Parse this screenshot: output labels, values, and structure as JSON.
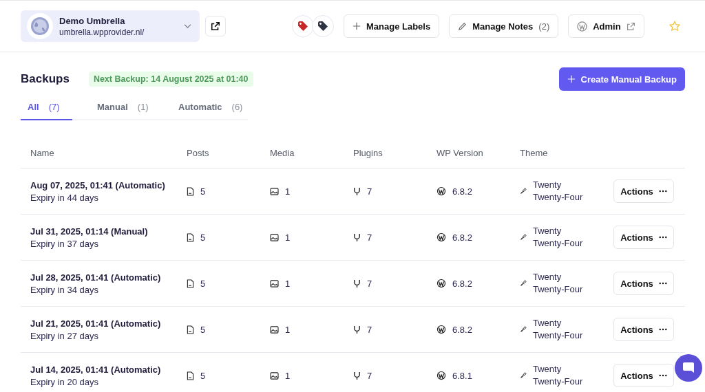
{
  "site": {
    "name": "Demo Umbrella",
    "url": "umbrella.wpprovider.nl/"
  },
  "labels": [
    {
      "color": "#c62828"
    },
    {
      "color": "#2d3340"
    }
  ],
  "header_buttons": [
    {
      "kind": "labels",
      "label": "Manage Labels"
    },
    {
      "kind": "notes",
      "label": "Manage Notes",
      "count": "(2)"
    },
    {
      "kind": "admin",
      "label": "Admin"
    }
  ],
  "favorite": {
    "on": false
  },
  "title": "Backups",
  "next_backup": "Next Backup: 14 August 2025 at 01:40",
  "create_button": "Create Manual Backup",
  "tabs": [
    {
      "label": "All",
      "count": "(7)",
      "selected": true
    },
    {
      "label": "Manual",
      "count": "(1)",
      "selected": false
    },
    {
      "label": "Automatic",
      "count": "(6)",
      "selected": false
    }
  ],
  "table": {
    "columns": [
      "Name",
      "Posts",
      "Media",
      "Plugins",
      "WP Version",
      "Theme"
    ],
    "rows": [
      {
        "name": "Aug 07, 2025, 01:41 (Automatic)",
        "expiry": "Expiry in 44 days",
        "posts": "5",
        "media": "1",
        "plugins": "7",
        "wp_version": "6.8.2",
        "theme": "Twenty Twenty-Four",
        "action": "Actions"
      },
      {
        "name": "Jul 31, 2025, 01:14 (Manual)",
        "expiry": "Expiry in 37 days",
        "posts": "5",
        "media": "1",
        "plugins": "7",
        "wp_version": "6.8.2",
        "theme": "Twenty Twenty-Four",
        "action": "Actions"
      },
      {
        "name": "Jul 28, 2025, 01:41 (Automatic)",
        "expiry": "Expiry in 34 days",
        "posts": "5",
        "media": "1",
        "plugins": "7",
        "wp_version": "6.8.2",
        "theme": "Twenty Twenty-Four",
        "action": "Actions"
      },
      {
        "name": "Jul 21, 2025, 01:41 (Automatic)",
        "expiry": "Expiry in 27 days",
        "posts": "5",
        "media": "1",
        "plugins": "7",
        "wp_version": "6.8.2",
        "theme": "Twenty Twenty-Four",
        "action": "Actions"
      },
      {
        "name": "Jul 14, 2025, 01:41 (Automatic)",
        "expiry": "Expiry in 20 days",
        "posts": "5",
        "media": "1",
        "plugins": "7",
        "wp_version": "6.8.1",
        "theme": "Twenty Twenty-Four",
        "action": "Actions"
      }
    ]
  }
}
